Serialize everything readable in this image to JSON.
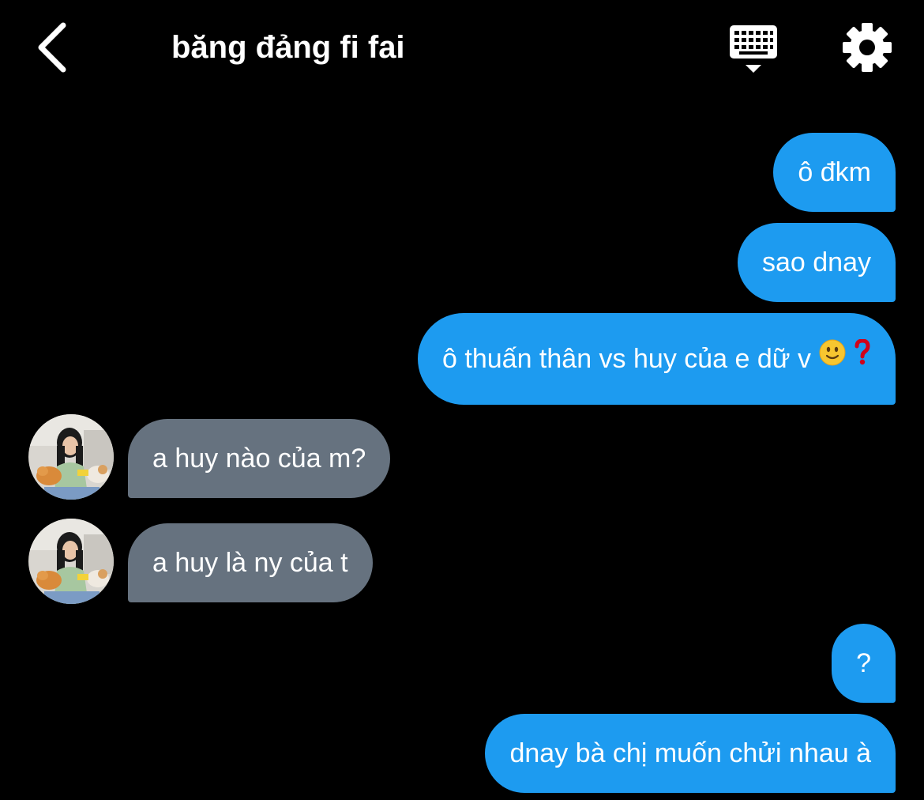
{
  "header": {
    "title": "băng đảng fi fai",
    "back_icon": "chevron-left-icon",
    "keyboard_icon": "keyboard-icon",
    "settings_icon": "gear-icon"
  },
  "colors": {
    "background": "#000000",
    "outgoing_bubble": "#1d9bf0",
    "incoming_bubble": "#66727f",
    "text": "#ffffff",
    "question_mark_emoji": "#d0021b"
  },
  "messages": [
    {
      "direction": "outgoing",
      "text": "ô đkm"
    },
    {
      "direction": "outgoing",
      "text": "sao dnay"
    },
    {
      "direction": "outgoing",
      "text": "ô thuấn thân vs huy của e dữ v",
      "emojis": [
        "slightly-smiling-face-emoji",
        "red-question-mark-emoji"
      ]
    },
    {
      "direction": "incoming",
      "text": "a huy nào của m?",
      "avatar": "avatar-girl-with-cats"
    },
    {
      "direction": "incoming",
      "text": "a huy là ny của t",
      "avatar": "avatar-girl-with-cats"
    },
    {
      "direction": "outgoing",
      "text": "?"
    },
    {
      "direction": "outgoing",
      "text": "dnay bà chị muốn chửi nhau à"
    }
  ]
}
